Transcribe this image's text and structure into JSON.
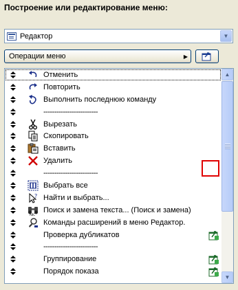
{
  "title": "Построение или редактирование меню:",
  "menu_select": {
    "value": "Редактор",
    "icon": "window-icon"
  },
  "operations_button": {
    "label": "Операции меню"
  },
  "add_button": {
    "icon": "add-to-menu-icon"
  },
  "list": {
    "items": [
      {
        "label": "Отменить",
        "icon": "undo-icon",
        "selected": true
      },
      {
        "label": "Повторить",
        "icon": "redo-icon"
      },
      {
        "label": "Выполнить последнюю команду",
        "icon": "repeat-icon"
      },
      {
        "label": "-------------------------",
        "icon": "",
        "separator": true
      },
      {
        "label": "Вырезать",
        "icon": "scissors-icon"
      },
      {
        "label": "Скопировать",
        "icon": "copy-icon"
      },
      {
        "label": "Вставить",
        "icon": "paste-icon"
      },
      {
        "label": "Удалить",
        "icon": "delete-x-icon"
      },
      {
        "label": "-------------------------",
        "icon": "",
        "separator": true
      },
      {
        "label": "Выбрать все",
        "icon": "select-all-icon"
      },
      {
        "label": "Найти и выбрать...",
        "icon": "find-select-icon"
      },
      {
        "label": "Поиск и замена текста... (Поиск и замена)",
        "icon": "binoculars-icon"
      },
      {
        "label": "Команды расширений в меню Редактор.",
        "icon": "extension-icon"
      },
      {
        "label": "Проверка дубликатов",
        "icon": "",
        "right_icon": "add-to-menu-icon"
      },
      {
        "label": "-------------------------",
        "icon": "",
        "separator": true
      },
      {
        "label": "Группирование",
        "icon": "",
        "right_icon": "add-to-menu-icon"
      },
      {
        "label": "Порядок показа",
        "icon": "",
        "right_icon": "add-to-menu-icon"
      }
    ]
  },
  "colors": {
    "highlight_box": "#e00000",
    "scroll_accent": "#b6ccf8"
  }
}
